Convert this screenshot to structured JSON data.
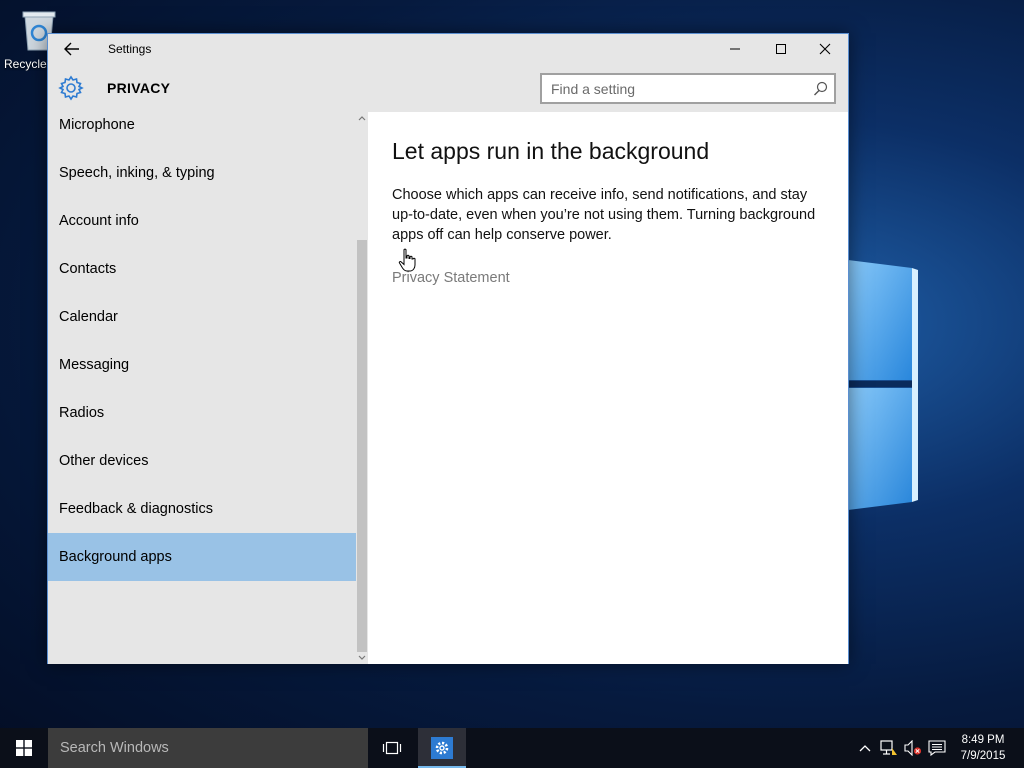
{
  "desktop": {
    "recycle_bin_label": "Recycle Bin"
  },
  "window": {
    "title": "Settings",
    "section": "PRIVACY",
    "search": {
      "placeholder": "Find a setting"
    }
  },
  "sidebar": {
    "items": [
      {
        "label": "Microphone"
      },
      {
        "label": "Speech, inking, & typing"
      },
      {
        "label": "Account info"
      },
      {
        "label": "Contacts"
      },
      {
        "label": "Calendar"
      },
      {
        "label": "Messaging"
      },
      {
        "label": "Radios"
      },
      {
        "label": "Other devices"
      },
      {
        "label": "Feedback & diagnostics"
      },
      {
        "label": "Background apps",
        "selected": true
      }
    ]
  },
  "content": {
    "title": "Let apps run in the background",
    "description": "Choose which apps can receive info, send notifications, and stay up-to-date, even when you’re not using them. Turning background apps off can help conserve power.",
    "link": "Privacy Statement"
  },
  "taskbar": {
    "search_placeholder": "Search Windows",
    "time": "8:49 PM",
    "date": "7/9/2015"
  },
  "icons": [
    "back-arrow-icon",
    "settings-gear-icon",
    "search-icon",
    "minimize-icon",
    "maximize-icon",
    "close-icon",
    "windows-logo-icon",
    "task-view-icon",
    "chevron-up-icon",
    "network-icon",
    "volume-muted-icon",
    "action-center-icon",
    "hand-cursor-icon",
    "recycle-bin-icon"
  ],
  "colors": {
    "accent": "#99c2e6",
    "chrome": "#e6e6e6",
    "taskbar": "#0b0f19",
    "link": "#7a7a7a"
  }
}
